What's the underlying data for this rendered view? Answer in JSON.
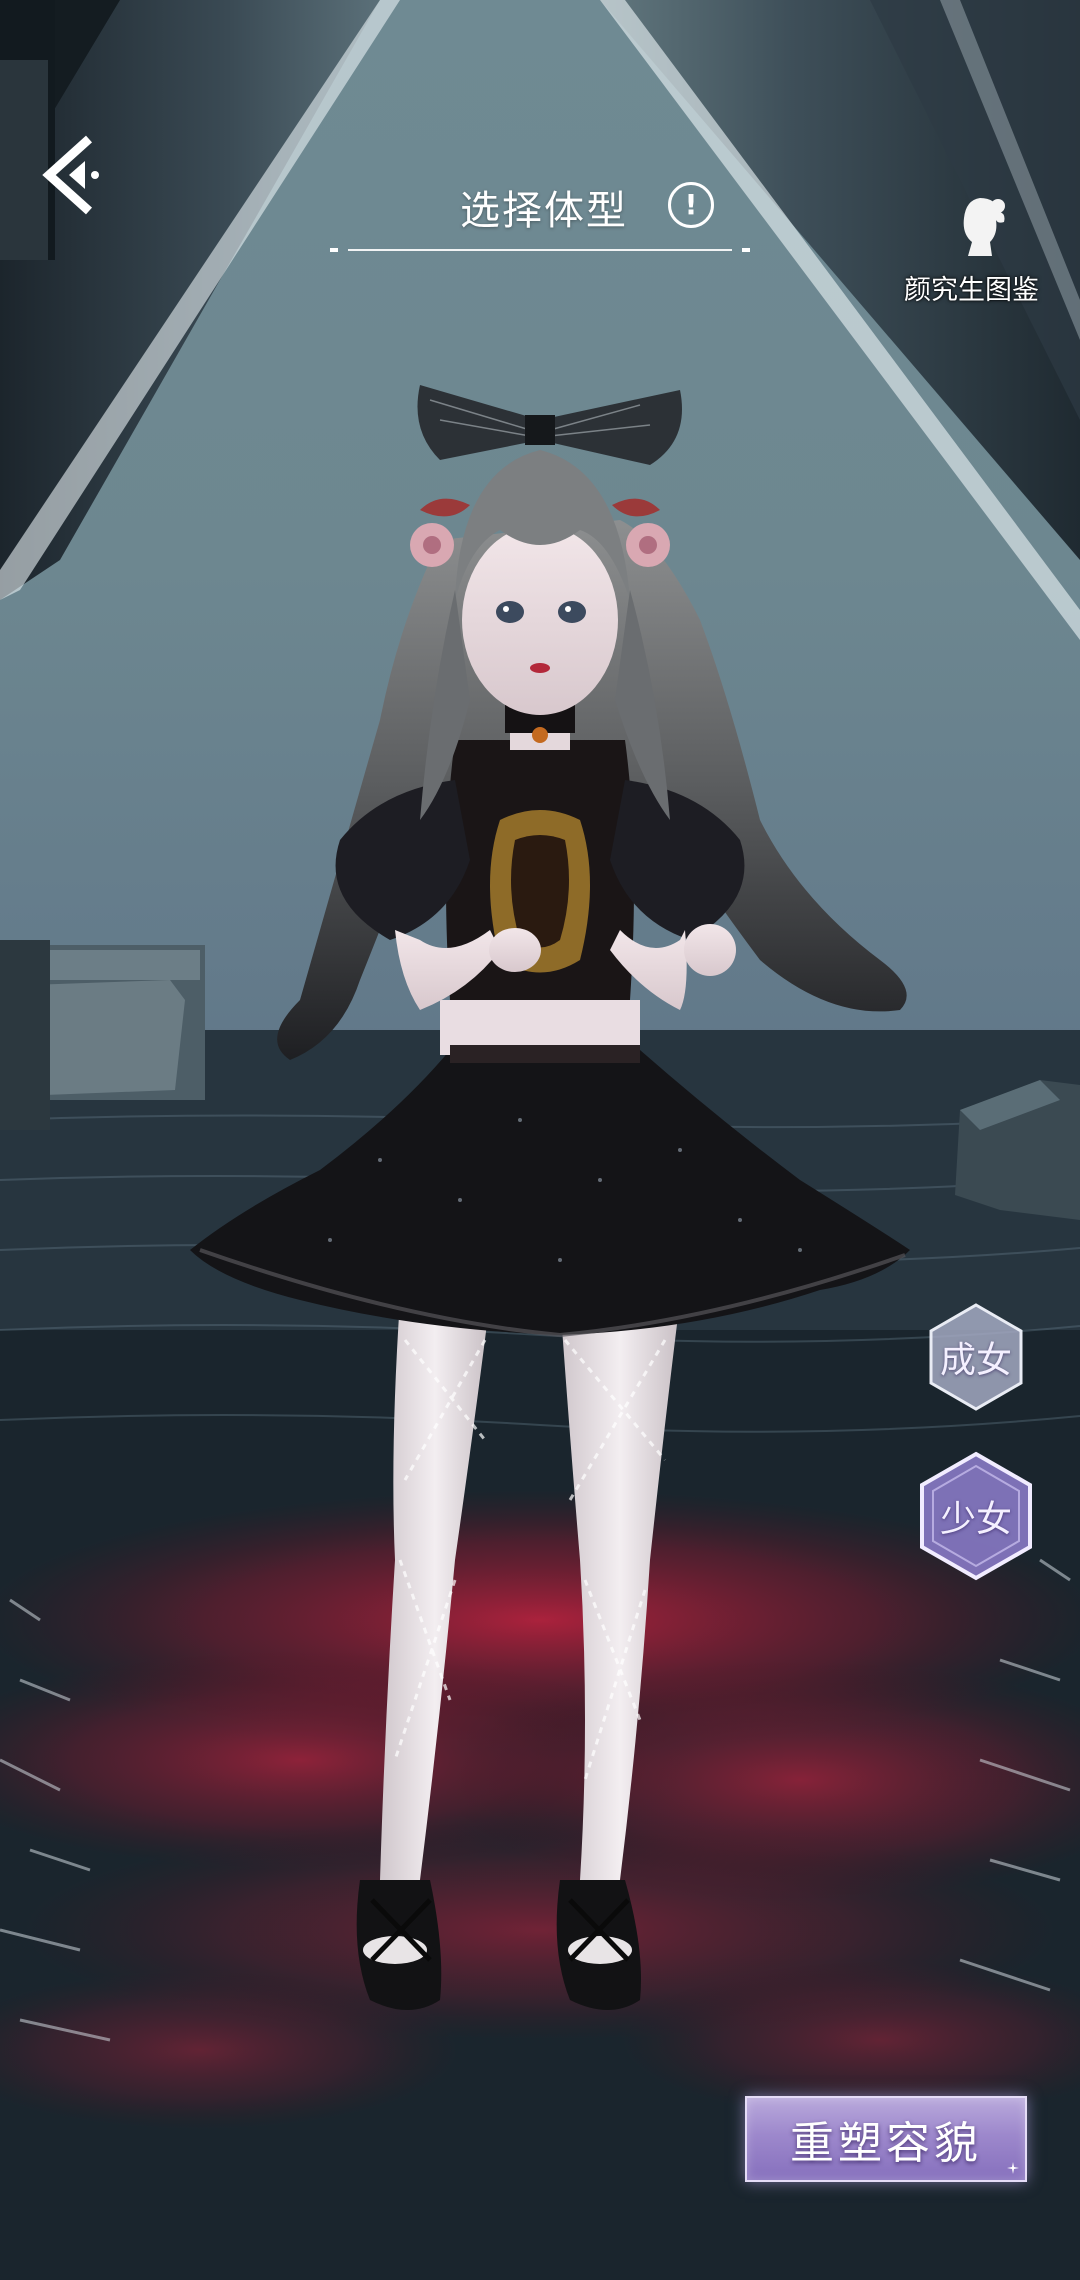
{
  "header": {
    "title": "选择体型",
    "back_icon": "chevron-back-icon",
    "info_icon": "exclamation-icon"
  },
  "codex": {
    "label": "颜究生图鉴",
    "icon": "girl-silhouette-icon"
  },
  "body_types": [
    {
      "label": "成女",
      "selected": false
    },
    {
      "label": "少女",
      "selected": true
    }
  ],
  "reshape_button": {
    "label": "重塑容貌"
  },
  "colors": {
    "accent": "#9d88cc",
    "selected_hex": "#8a7ac4",
    "unselected_hex": "#a8aec7",
    "sky": "#6f8a93",
    "water": "#0e1418",
    "red_reflection": "#b01e3a"
  }
}
